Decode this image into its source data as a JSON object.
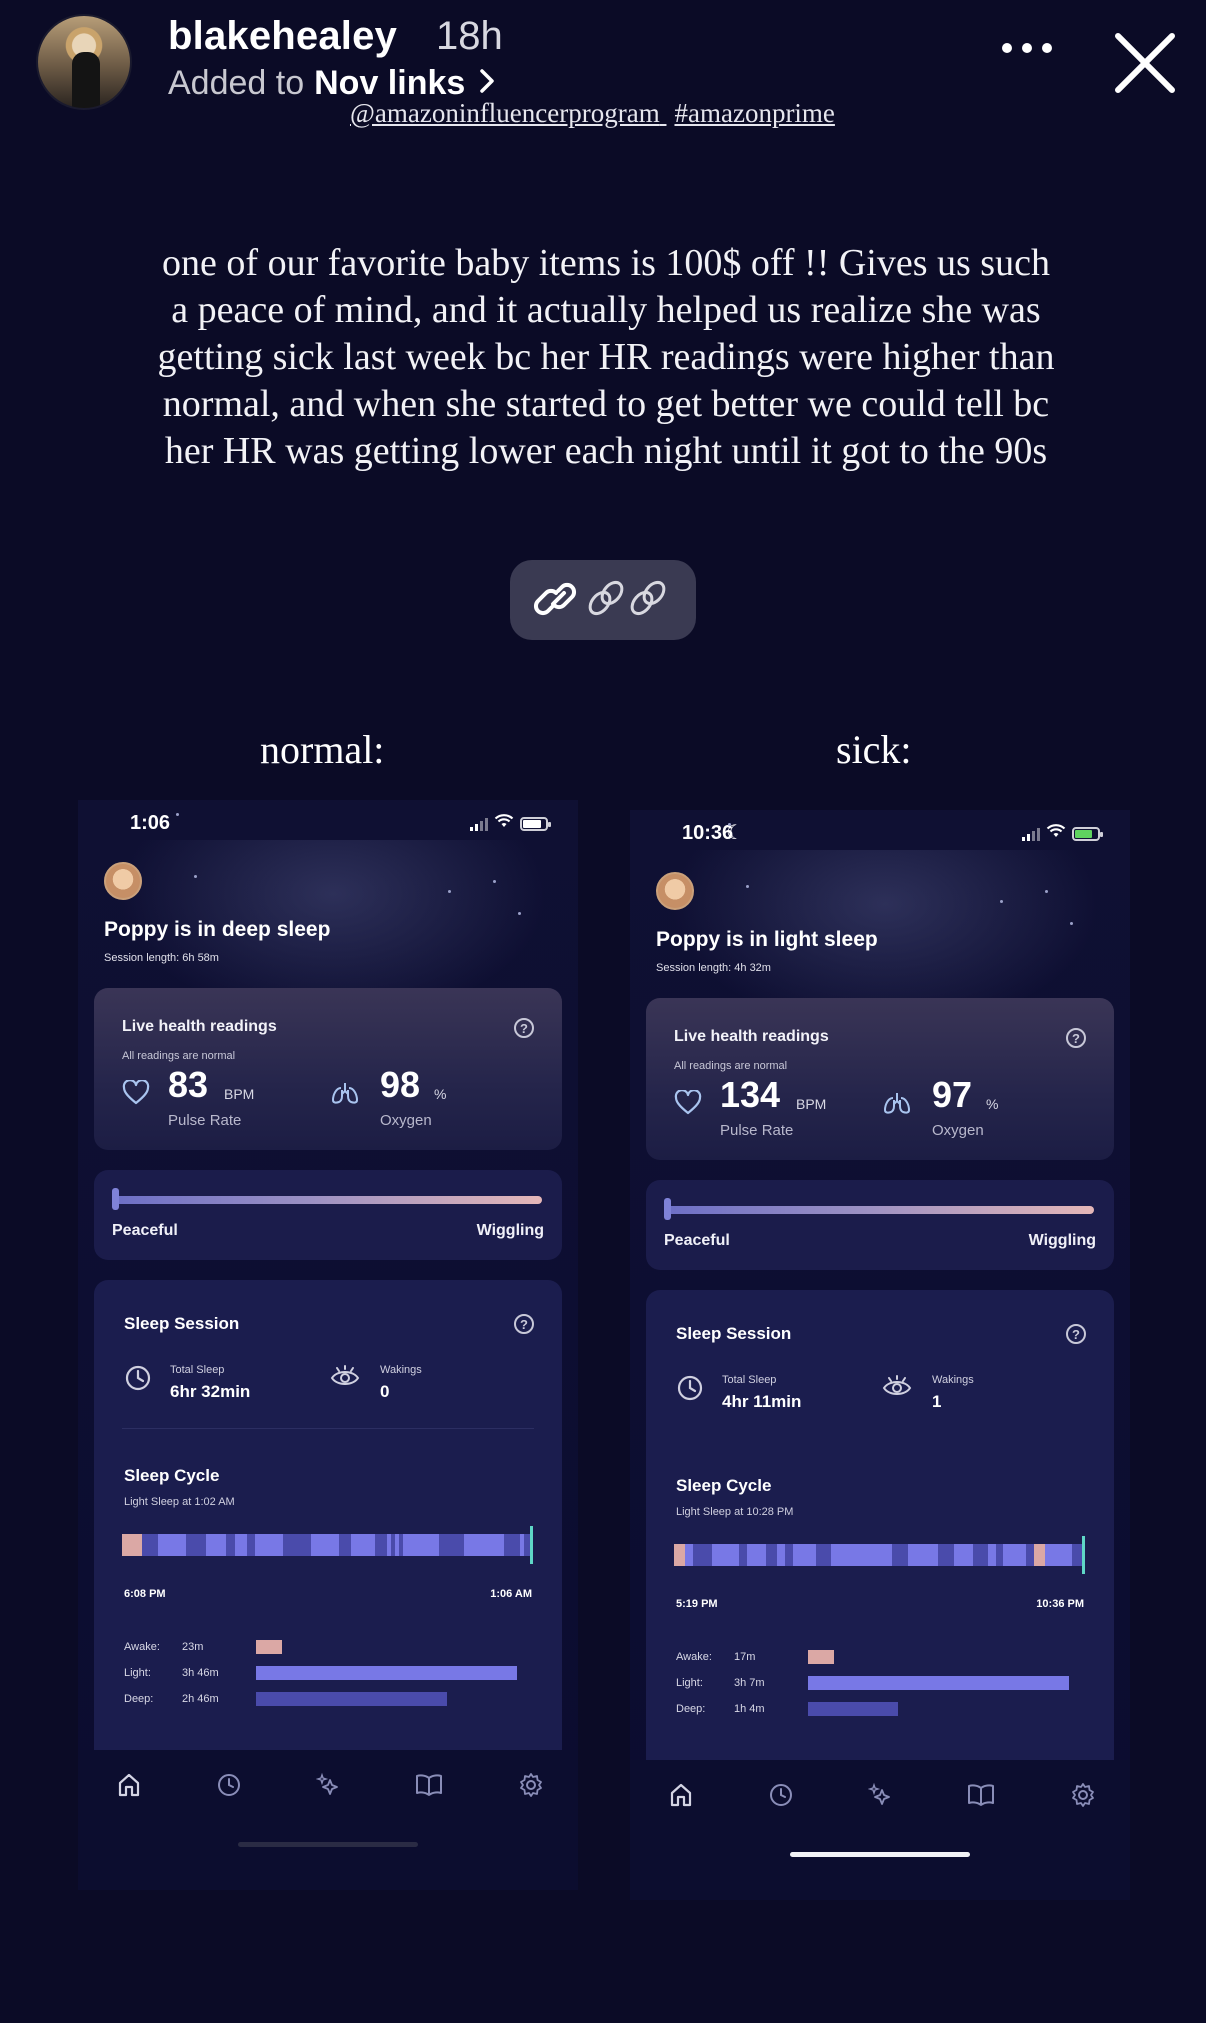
{
  "story": {
    "username": "blakehealey",
    "time_ago": "18h",
    "added_prefix": "Added to",
    "added_highlight": "Nov links",
    "tags": [
      "@amazoninfluencerprogram",
      "#amazonprime"
    ],
    "caption": "one of our favorite baby items is 100$ off !! Gives us such a peace of mind, and it actually helped us realize she was getting sick last week bc her HR readings were higher than normal, and when she started to get better we could tell bc her HR was getting lower each night until it got to the 90s",
    "link_icon": "link-chain-icon"
  },
  "colors": {
    "awake": "#dba8a5",
    "light": "#7878e6",
    "deep": "#4a4bab",
    "accent_now": "#5fd7c7"
  },
  "panels": [
    {
      "label": "normal:",
      "time": "1:06",
      "moon": "",
      "charging": false,
      "battery_level": 0.8,
      "baby_status": "Poppy is in deep sleep",
      "session_length": "Session length: 6h 58m",
      "health": {
        "title": "Live health readings",
        "subtitle": "All readings are normal",
        "pulse": "83",
        "pulse_unit": "BPM",
        "pulse_label": "Pulse Rate",
        "oxygen": "98",
        "oxygen_unit": "%",
        "oxygen_label": "Oxygen"
      },
      "movement": {
        "left": "Peaceful",
        "right": "Wiggling",
        "level": 0.0
      },
      "session": {
        "title": "Sleep Session",
        "total_label": "Total Sleep",
        "total": "6hr 32min",
        "wakings_label": "Wakings",
        "wakings": "0",
        "cycle_title": "Sleep Cycle",
        "cycle_sub": "Light Sleep at 1:02 AM",
        "start": "6:08 PM",
        "end": "1:06 AM",
        "segments": [
          [
            "awake",
            5
          ],
          [
            "deep",
            4
          ],
          [
            "light",
            7
          ],
          [
            "deep",
            5
          ],
          [
            "light",
            5
          ],
          [
            "deep",
            2
          ],
          [
            "light",
            3
          ],
          [
            "deep",
            2
          ],
          [
            "light",
            7
          ],
          [
            "deep",
            7
          ],
          [
            "light",
            7
          ],
          [
            "deep",
            3
          ],
          [
            "light",
            6
          ],
          [
            "deep",
            3
          ],
          [
            "light",
            1
          ],
          [
            "deep",
            1
          ],
          [
            "light",
            1
          ],
          [
            "deep",
            1
          ],
          [
            "light",
            9
          ],
          [
            "deep",
            6
          ],
          [
            "light",
            10
          ],
          [
            "deep",
            4
          ],
          [
            "light",
            1
          ],
          [
            "deep",
            2
          ]
        ],
        "legend": [
          {
            "key": "Awake:",
            "value": "23m",
            "stage": "awake",
            "fraction": 0.09
          },
          {
            "key": "Light:",
            "value": "3h 46m",
            "stage": "light",
            "fraction": 0.9
          },
          {
            "key": "Deep:",
            "value": "2h 46m",
            "stage": "deep",
            "fraction": 0.66
          }
        ]
      }
    },
    {
      "label": "sick:",
      "time": "10:36",
      "moon": "☾",
      "charging": true,
      "battery_level": 0.75,
      "baby_status": "Poppy is in light sleep",
      "session_length": "Session length: 4h 32m",
      "health": {
        "title": "Live health readings",
        "subtitle": "All readings are normal",
        "pulse": "134",
        "pulse_unit": "BPM",
        "pulse_label": "Pulse Rate",
        "oxygen": "97",
        "oxygen_unit": "%",
        "oxygen_label": "Oxygen"
      },
      "movement": {
        "left": "Peaceful",
        "right": "Wiggling",
        "level": 0.0
      },
      "session": {
        "title": "Sleep Session",
        "total_label": "Total Sleep",
        "total": "4hr 11min",
        "wakings_label": "Wakings",
        "wakings": "1",
        "cycle_title": "Sleep Cycle",
        "cycle_sub": "Light Sleep at 10:28 PM",
        "start": "5:19 PM",
        "end": "10:36 PM",
        "segments": [
          [
            "awake",
            3
          ],
          [
            "light",
            2
          ],
          [
            "deep",
            5
          ],
          [
            "light",
            7
          ],
          [
            "deep",
            2
          ],
          [
            "light",
            5
          ],
          [
            "deep",
            3
          ],
          [
            "light",
            2
          ],
          [
            "deep",
            2
          ],
          [
            "light",
            6
          ],
          [
            "deep",
            4
          ],
          [
            "light",
            16
          ],
          [
            "deep",
            4
          ],
          [
            "light",
            8
          ],
          [
            "deep",
            4
          ],
          [
            "light",
            5
          ],
          [
            "deep",
            4
          ],
          [
            "light",
            2
          ],
          [
            "deep",
            2
          ],
          [
            "light",
            6
          ],
          [
            "deep",
            2
          ],
          [
            "awake",
            3
          ],
          [
            "light",
            7
          ],
          [
            "deep",
            3
          ]
        ],
        "legend": [
          {
            "key": "Awake:",
            "value": "17m",
            "stage": "awake",
            "fraction": 0.09
          },
          {
            "key": "Light:",
            "value": "3h 7m",
            "stage": "light",
            "fraction": 0.9
          },
          {
            "key": "Deep:",
            "value": "1h 4m",
            "stage": "deep",
            "fraction": 0.31
          }
        ]
      }
    }
  ],
  "tabbar": [
    "home-icon",
    "history-clock-icon",
    "sparkles-icon",
    "book-icon",
    "settings-gear-icon"
  ]
}
